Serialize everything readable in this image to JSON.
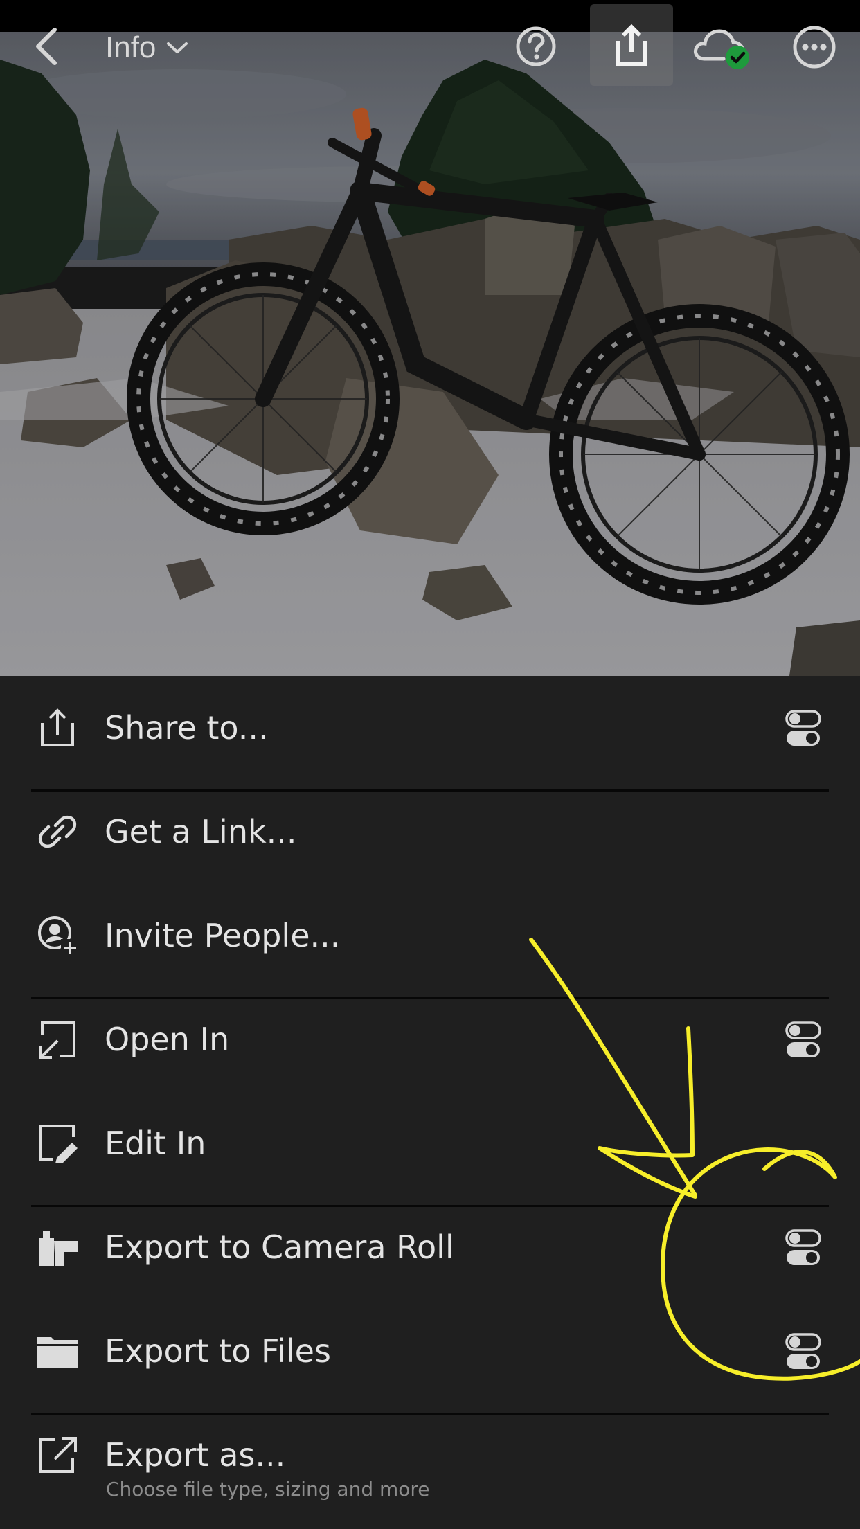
{
  "app": {
    "header_title": "Info",
    "icons": {
      "back": "chevron-left-icon",
      "title_dropdown": "caret-down-icon",
      "help": "help-circle-icon",
      "share": "share-icon",
      "cloud_sync": "cloud-synced-icon",
      "more": "more-horizontal-icon"
    }
  },
  "photo": {
    "description_alt": ""
  },
  "menu": {
    "items": [
      {
        "label": "Share to...",
        "icon": "share-to-icon",
        "has_settings": true
      },
      {
        "label": "Get a Link...",
        "icon": "link-icon",
        "has_settings": false
      },
      {
        "label": "Invite People...",
        "icon": "invite-people-icon",
        "has_settings": false
      },
      {
        "label": "Open In",
        "icon": "open-in-icon",
        "has_settings": true
      },
      {
        "label": "Edit In",
        "icon": "edit-in-icon",
        "has_settings": false
      },
      {
        "label": "Export to Camera Roll",
        "icon": "camera-roll-icon",
        "has_settings": true
      },
      {
        "label": "Export to Files",
        "icon": "folder-icon",
        "has_settings": true
      },
      {
        "label": "Export as...",
        "sublabel": "Choose file type, sizing and more",
        "icon": "export-icon",
        "has_settings": false
      }
    ]
  },
  "colors": {
    "background": "#1f1f1f",
    "text": "#e4e4e4",
    "subtext": "#8c8c8c",
    "divider": "#070707",
    "sync_badge": "#1e9a3c",
    "annotation": "#f7ee2a"
  }
}
